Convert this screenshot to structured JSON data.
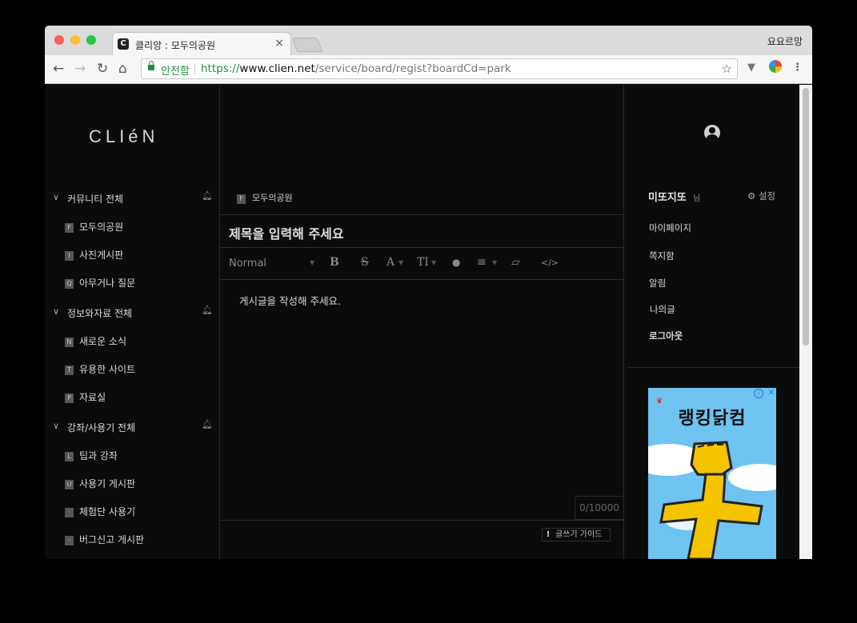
{
  "browser": {
    "tab_title": "클리앙 : 모두의공원",
    "tab_favicon": "C",
    "tab_close": "×",
    "profile_name": "요요르망",
    "secure_label": "안전함",
    "url_scheme": "https://",
    "url_host": "www.clien.net",
    "url_path": "/service/board/regist?boardCd=park",
    "nav": {
      "back": "←",
      "forward": "→",
      "reload": "↻",
      "home": "⌂",
      "star": "☆"
    }
  },
  "sidebar": {
    "logo": "CLIéN",
    "sections": [
      {
        "label": "커뮤니티 전체",
        "items": [
          {
            "badge": "F",
            "label": "모두의공원"
          },
          {
            "badge": "I",
            "label": "사진게시판"
          },
          {
            "badge": "Q",
            "label": "아무거나 질문"
          }
        ]
      },
      {
        "label": "정보와자료 전체",
        "items": [
          {
            "badge": "N",
            "label": "새로운 소식"
          },
          {
            "badge": "T",
            "label": "유용한 사이트"
          },
          {
            "badge": "P",
            "label": "자료실"
          }
        ]
      },
      {
        "label": "강좌/사용기 전체",
        "items": [
          {
            "badge": "L",
            "label": "팁과 강좌"
          },
          {
            "badge": "U",
            "label": "사용기 게시판"
          },
          {
            "badge": "·",
            "label": "체험단 사용기"
          },
          {
            "badge": "·",
            "label": "버그신고 게시판"
          }
        ]
      }
    ]
  },
  "main": {
    "breadcrumb_badge": "F",
    "breadcrumb": "모두의공원",
    "title_placeholder": "제목을 입력해 주세요",
    "editor_format": "Normal",
    "body_placeholder": "게시글을 작성해 주세요.",
    "counter": "0/10000",
    "guide_label": "글쓰기 가이드",
    "guide_icon": "!"
  },
  "user": {
    "name": "미또지또",
    "honorific": "님",
    "settings_label": "설정",
    "menu": [
      "마이페이지",
      "쪽지함",
      "알림",
      "나의글",
      "로그아웃"
    ]
  },
  "ad": {
    "text": "랭킹닭컴",
    "close": "✕",
    "info": "i"
  },
  "colors": {
    "background": "#0b0b0b",
    "text": "#d9d9d9",
    "secure_green": "#1e8e3e",
    "ad_sky": "#6ec3f0"
  }
}
